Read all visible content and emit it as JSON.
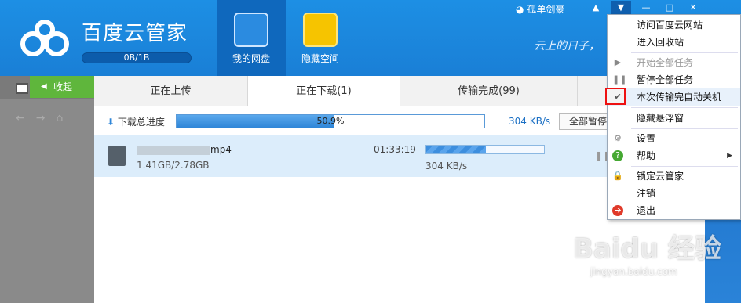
{
  "app": {
    "title": "百度云管家",
    "quota": "0B/1B",
    "slogan": "云上的日子，"
  },
  "nav": [
    {
      "label": "我的网盘"
    },
    {
      "label": "隐藏空间"
    }
  ],
  "user": {
    "name": "孤单剑豪"
  },
  "sidebar": {
    "collapse_label": "收起"
  },
  "tabs": [
    {
      "label": "正在上传"
    },
    {
      "label": "正在下载(1)"
    },
    {
      "label": "传输完成(99)"
    }
  ],
  "progress": {
    "label": "下载总进度",
    "percent_text": "50.9%",
    "percent": 50.9,
    "speed": "304 KB/s",
    "pause_all": "全部暂停"
  },
  "download": {
    "filename_suffix": "mp4",
    "size": "1.41GB/2.78GB",
    "time_left": "01:33:19",
    "speed": "304 KB/s",
    "progress_percent": 50.7
  },
  "menu": {
    "items": [
      {
        "label": "访问百度云网站",
        "disabled": false
      },
      {
        "label": "进入回收站",
        "disabled": false
      },
      {
        "label": "开始全部任务",
        "disabled": true
      },
      {
        "label": "暂停全部任务",
        "disabled": false
      },
      {
        "label": "本次传输完自动关机",
        "disabled": false,
        "checked": true
      },
      {
        "label": "隐藏悬浮窗",
        "disabled": false
      },
      {
        "label": "设置",
        "disabled": false
      },
      {
        "label": "帮助",
        "disabled": false,
        "has_submenu": true
      },
      {
        "label": "锁定云管家",
        "disabled": false
      },
      {
        "label": "注销",
        "disabled": false
      },
      {
        "label": "退出",
        "disabled": false
      }
    ]
  },
  "watermark": {
    "brand": "Baidu 经验",
    "url": "jingyan.baidu.com"
  },
  "colors": {
    "header": "#1a7fd6",
    "accent_green": "#5fb63c",
    "progress": "#2f86d8",
    "highlight_box": "#e11111"
  }
}
